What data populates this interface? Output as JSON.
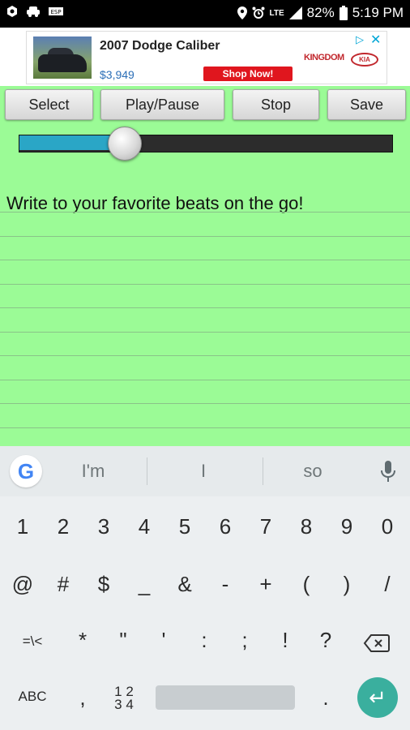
{
  "status_bar": {
    "battery": "82%",
    "time": "5:19 PM",
    "network": "LTE",
    "icons": [
      "settings-icon",
      "car-icon",
      "voicemail-icon",
      "location-icon",
      "alarm-icon",
      "signal-icon",
      "battery-icon"
    ]
  },
  "ad": {
    "title": "2007 Dodge Caliber",
    "price": "$3,949",
    "cta": "Shop Now!",
    "brand": "KINGDOM",
    "logo": "KIA"
  },
  "toolbar": {
    "select_label": "Select",
    "play_pause_label": "Play/Pause",
    "stop_label": "Stop",
    "save_label": "Save"
  },
  "player": {
    "progress_fraction": 0.28
  },
  "notepad": {
    "text": "Write to your favorite beats on the go!"
  },
  "keyboard": {
    "suggestions": [
      "I'm",
      "I",
      "so"
    ],
    "row_numbers": [
      "1",
      "2",
      "3",
      "4",
      "5",
      "6",
      "7",
      "8",
      "9",
      "0"
    ],
    "row_symbols1": [
      "@",
      "#",
      "$",
      "_",
      "&",
      "-",
      "+",
      "(",
      ")",
      "/"
    ],
    "row_symbols2": [
      "=\\<",
      "*",
      "\"",
      "'",
      ":",
      ";",
      "!",
      "?"
    ],
    "abc_label": "ABC",
    "comma": ",",
    "numpad_label_top": "1 2",
    "numpad_label_bottom": "3 4",
    "period": "."
  },
  "colors": {
    "background": "#9bfb96",
    "slider_fill": "#2aa6c6",
    "enter_key": "#3aaf9e",
    "shop_button": "#e0161e"
  }
}
